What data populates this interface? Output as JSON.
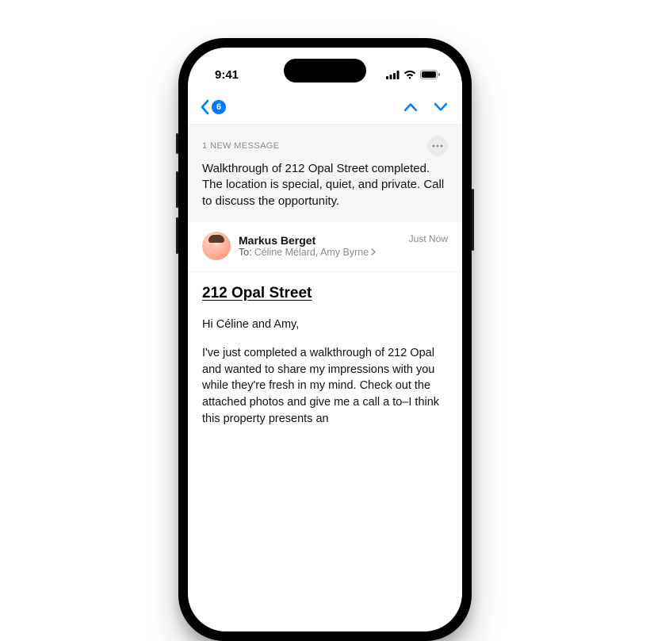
{
  "statusbar": {
    "time": "9:41"
  },
  "navbar": {
    "unread_count": "6"
  },
  "summary": {
    "label": "1 NEW MESSAGE",
    "text": "Walkthrough of 212 Opal Street completed. The location is special, quiet, and private. Call to discuss the opportunity."
  },
  "sender": {
    "name": "Markus Berget",
    "to_prefix": "To:",
    "recipients": "Céline Mélard, Amy Byrne",
    "timestamp": "Just Now"
  },
  "email": {
    "subject": "212 Opal Street ",
    "greeting": "Hi Céline and Amy,",
    "body": "I've just completed a walkthrough of 212 Opal and wanted to share my impressions with you while they're fresh in my mind. Check out the attached photos and give me a call a to–I think this property presents an"
  },
  "colors": {
    "accent": "#007aff"
  }
}
